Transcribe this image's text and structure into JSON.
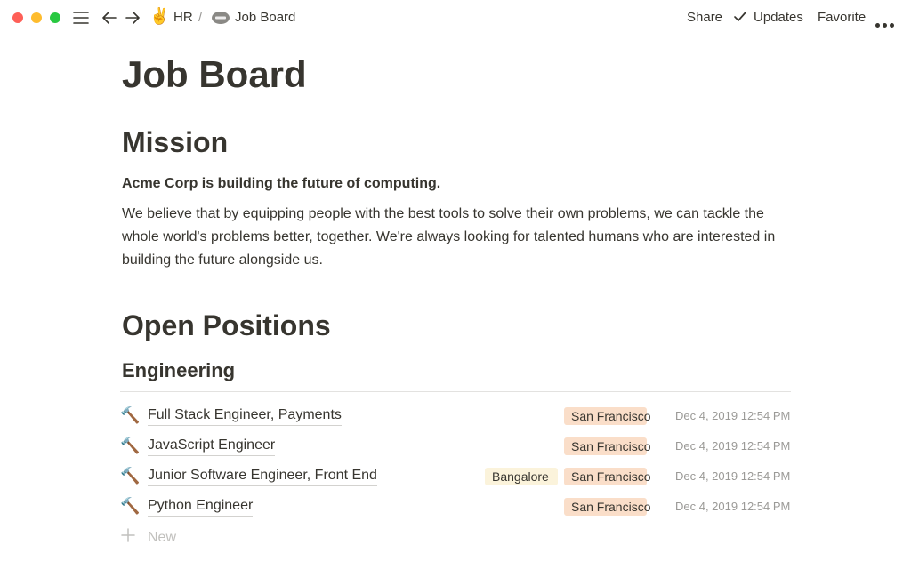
{
  "toolbar": {
    "breadcrumbs": [
      {
        "label": "HR",
        "emoji": "✌️"
      },
      {
        "label": "Job Board",
        "icon": "acme-logo-icon"
      }
    ],
    "separator": "/",
    "share_label": "Share",
    "updates_label": "Updates",
    "favorite_label": "Favorite"
  },
  "page": {
    "title": "Job Board",
    "mission_heading": "Mission",
    "mission_bold": "Acme Corp is building the future of computing.",
    "mission_text": "We believe that by equipping people with the best tools to solve their own problems, we can tackle the whole world's problems better, together. We're always looking for talented humans who are interested in building the future alongside us.",
    "positions_heading": "Open Positions",
    "engineering_heading": "Engineering"
  },
  "jobs": [
    {
      "emoji": "🔨",
      "title": "Full Stack Engineer, Payments",
      "locations": [
        "San Francisco"
      ],
      "date": "Dec 4, 2019 12:54 PM"
    },
    {
      "emoji": "🔨",
      "title": "JavaScript Engineer",
      "locations": [
        "San Francisco"
      ],
      "date": "Dec 4, 2019 12:54 PM"
    },
    {
      "emoji": "🔨",
      "title": "Junior Software Engineer, Front End",
      "locations": [
        "Bangalore",
        "San Francisco"
      ],
      "date": "Dec 4, 2019 12:54 PM"
    },
    {
      "emoji": "🔨",
      "title": "Python Engineer",
      "locations": [
        "San Francisco"
      ],
      "date": "Dec 4, 2019 12:54 PM"
    }
  ],
  "new_label": "New",
  "colors": {
    "text": "#37352f",
    "muted": "#9b9a97",
    "tag_san_francisco": "#fadec9",
    "tag_bangalore": "#fbf3db",
    "close": "#fe5f57",
    "minimize": "#febc2e",
    "zoom": "#28c840"
  }
}
